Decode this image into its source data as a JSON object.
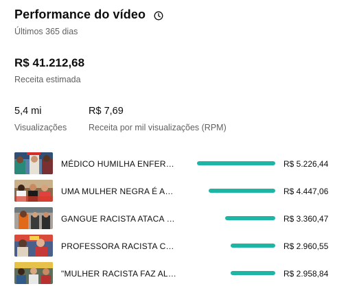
{
  "header": {
    "title": "Performance do vídeo",
    "subtitle": "Últimos 365 dias"
  },
  "revenue": {
    "value": "R$ 41.212,68",
    "label": "Receita estimada"
  },
  "metrics": {
    "views": {
      "value": "5,4 mi",
      "label": "Visualizações"
    },
    "rpm": {
      "value": "R$ 7,69",
      "label": "Receita por mil visualizações (RPM)"
    }
  },
  "colors": {
    "bar": "#1fb5a5"
  },
  "videos": [
    {
      "title": "MÉDICO HUMILHA ENFERMEIRA",
      "amount": "R$ 5.226,44",
      "share": 1.0
    },
    {
      "title": "UMA MULHER NEGRA É ACUSADA",
      "amount": "R$ 4.447,06",
      "share": 0.851
    },
    {
      "title": "GANGUE RACISTA ATACA HOMEM",
      "amount": "R$ 3.360,47",
      "share": 0.643
    },
    {
      "title": "PROFESSORA RACISTA CONFRONTA",
      "amount": "R$ 2.960,55",
      "share": 0.566
    },
    {
      "title": "\"MULHER RACISTA FAZ ALUNA",
      "amount": "R$ 2.958,84",
      "share": 0.566
    }
  ]
}
